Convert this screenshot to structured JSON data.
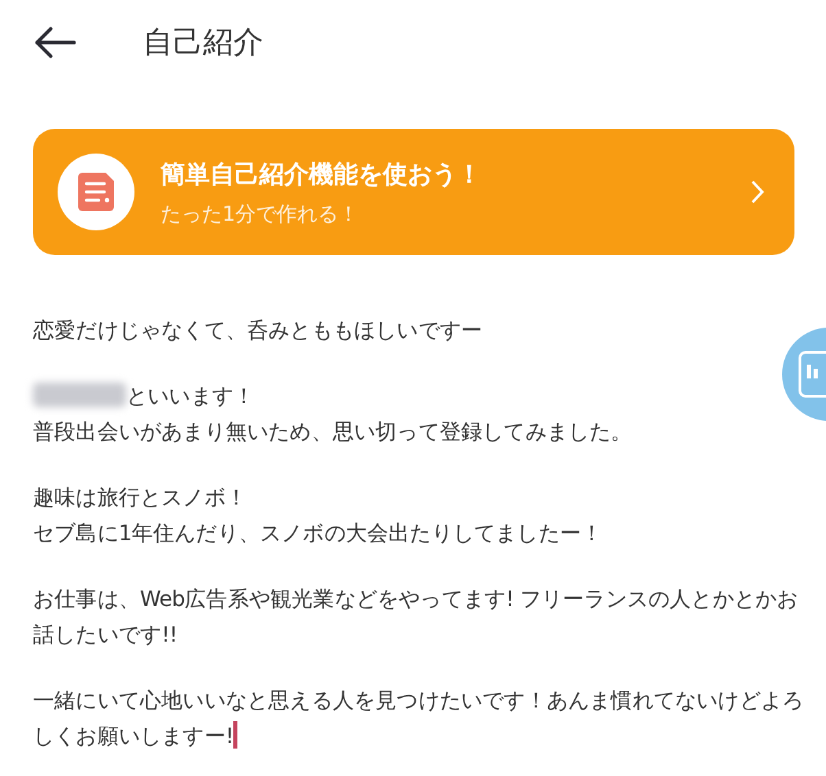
{
  "header": {
    "title": "自己紹介"
  },
  "banner": {
    "title": "簡単自己紹介機能を使おう！",
    "subtitle": "たった1分で作れる！"
  },
  "editor": {
    "caret": true,
    "paragraphs": [
      {
        "lines": [
          {
            "text": "恋愛だけじゃなくて、呑みとももほしいですー",
            "redacted_prefix": false
          }
        ]
      },
      {
        "lines": [
          {
            "text": "といいます！",
            "redacted_prefix": true
          },
          {
            "text": "普段出会いがあまり無いため、思い切って登録してみました。",
            "redacted_prefix": false
          }
        ]
      },
      {
        "lines": [
          {
            "text": "趣味は旅行とスノボ！",
            "redacted_prefix": false
          },
          {
            "text": "セブ島に1年住んだり、スノボの大会出たりしてましたー！",
            "redacted_prefix": false
          }
        ]
      },
      {
        "lines": [
          {
            "text": "お仕事は、Web広告系や観光業などをやってます! フリーランスの人とかとかお話したいです!!",
            "redacted_prefix": false
          }
        ]
      },
      {
        "lines": [
          {
            "text": "一緒にいて心地いいなと思える人を見つけたいです！あんま慣れてないけどよろしくお願いしますー!",
            "redacted_prefix": false
          }
        ]
      }
    ]
  }
}
